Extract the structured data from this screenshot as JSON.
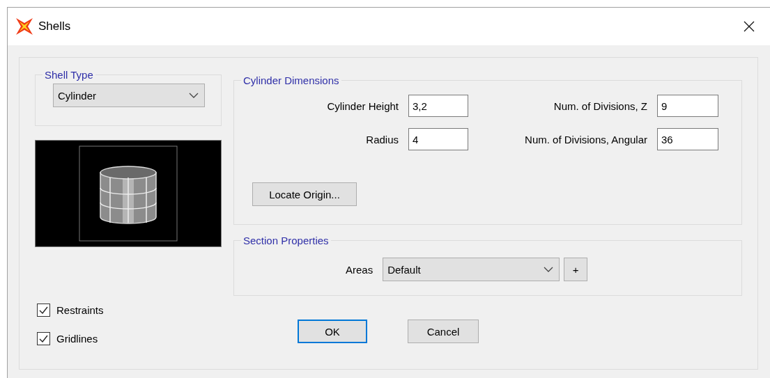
{
  "window": {
    "title": "Shells"
  },
  "shell_type": {
    "title": "Shell Type",
    "value": "Cylinder"
  },
  "cylinder_dimensions": {
    "title": "Cylinder Dimensions",
    "fields": [
      {
        "label": "Cylinder Height",
        "value": "3,2"
      },
      {
        "label": "Num. of Divisions, Z",
        "value": "9"
      },
      {
        "label": "Radius",
        "value": "4"
      },
      {
        "label": "Num. of Divisions, Angular",
        "value": "36"
      }
    ],
    "locate_button": "Locate Origin..."
  },
  "section_properties": {
    "title": "Section Properties",
    "areas_label": "Areas",
    "areas_value": "Default",
    "add_button": "+"
  },
  "options": [
    {
      "label": "Restraints",
      "checked": true
    },
    {
      "label": "Gridlines",
      "checked": true
    }
  ],
  "buttons": [
    {
      "label": "OK",
      "default": true
    },
    {
      "label": "Cancel",
      "default": false
    }
  ]
}
